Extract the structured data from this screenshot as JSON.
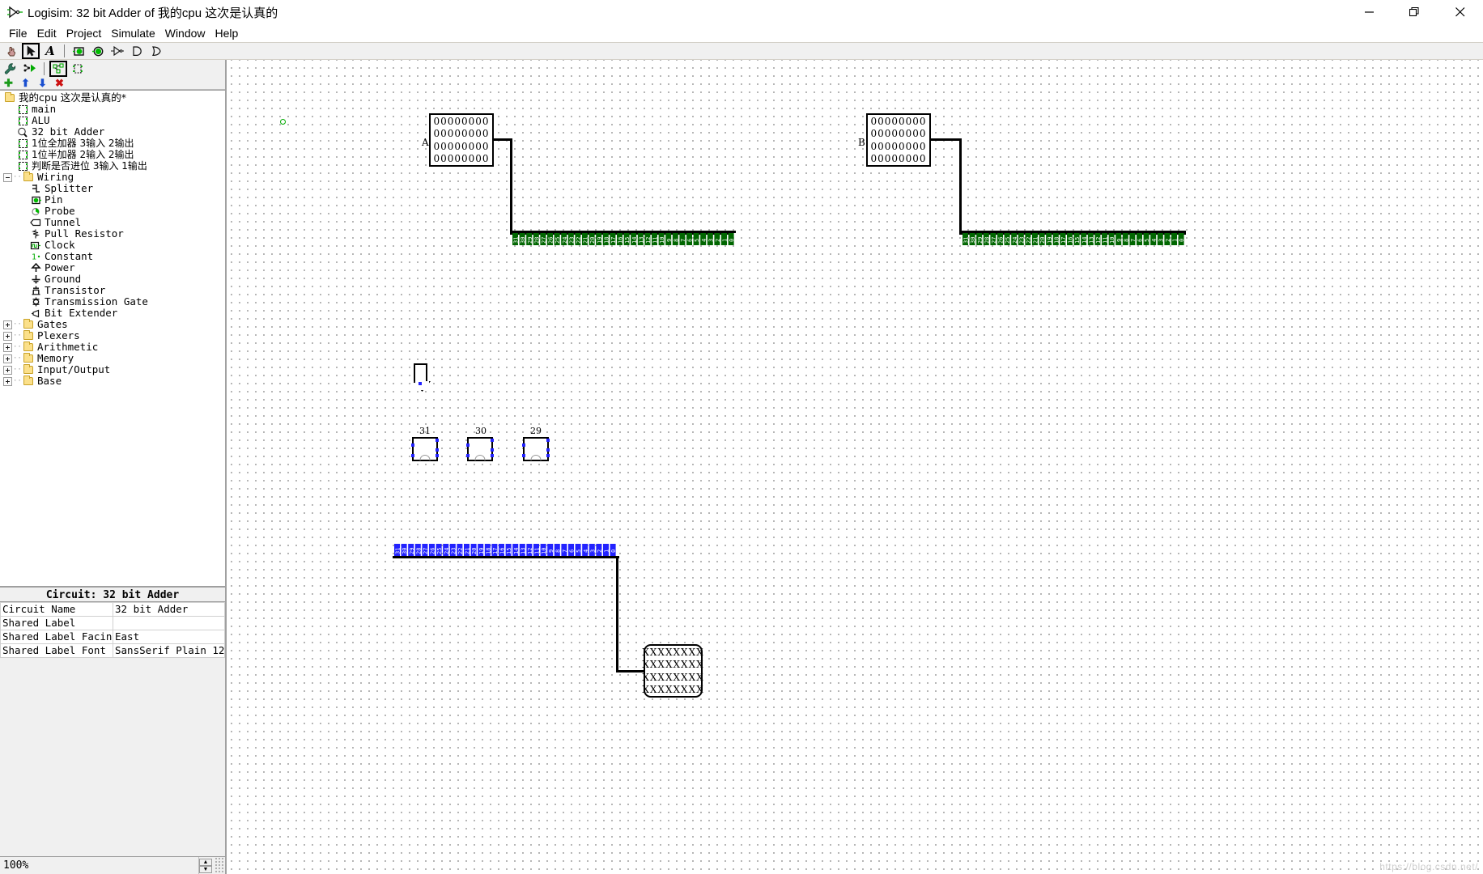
{
  "window": {
    "title": "Logisim: 32 bit Adder of 我的cpu 这次是认真的",
    "app_icon": "logisim-gate-icon",
    "minimize_label": "–",
    "maximize_label": "❐",
    "close_label": "✕"
  },
  "menubar": {
    "items": [
      {
        "label": "File",
        "name": "menu-file"
      },
      {
        "label": "Edit",
        "name": "menu-edit"
      },
      {
        "label": "Project",
        "name": "menu-project"
      },
      {
        "label": "Simulate",
        "name": "menu-simulate"
      },
      {
        "label": "Window",
        "name": "menu-window"
      },
      {
        "label": "Help",
        "name": "menu-help"
      }
    ]
  },
  "toolbar": {
    "tools": [
      {
        "name": "poke-tool",
        "icon": "hand-icon",
        "selected": false
      },
      {
        "name": "select-tool",
        "icon": "arrow-cursor-icon",
        "selected": true
      },
      {
        "name": "text-tool",
        "icon": "text-A-icon",
        "selected": false
      },
      {
        "name": "input-pin-tool",
        "icon": "input-pin-icon",
        "selected": false
      },
      {
        "name": "output-pin-tool",
        "icon": "output-pin-icon",
        "selected": false
      },
      {
        "name": "not-gate-tool",
        "icon": "not-gate-icon",
        "selected": false
      },
      {
        "name": "and-gate-tool",
        "icon": "and-gate-icon",
        "selected": false
      },
      {
        "name": "or-gate-tool",
        "icon": "or-gate-icon",
        "selected": false
      }
    ],
    "tools_row2": [
      {
        "name": "wrench-tool",
        "icon": "wrench-icon",
        "selected": false
      },
      {
        "name": "simulation-tool",
        "icon": "run-simulation-icon",
        "selected": false
      },
      {
        "name": "edit-circuit-tool",
        "icon": "edit-circuit-icon",
        "selected": true
      },
      {
        "name": "add-circuit-tool",
        "icon": "add-circuit-icon",
        "selected": false
      }
    ],
    "tools_row3": [
      {
        "name": "add-button",
        "icon": "plus-icon",
        "glyph": "✚",
        "color": "#1a9a1a"
      },
      {
        "name": "move-up-button",
        "icon": "arrow-up-icon",
        "glyph": "⬆",
        "color": "#1a4fd0"
      },
      {
        "name": "move-down-button",
        "icon": "arrow-down-icon",
        "glyph": "⬇",
        "color": "#1a4fd0"
      },
      {
        "name": "delete-button",
        "icon": "x-mark-icon",
        "glyph": "✖",
        "color": "#cc1111"
      }
    ]
  },
  "explorer": {
    "project_label": "我的cpu  这次是认真的*",
    "circuits": [
      {
        "label": "main",
        "name": "tree-item-main",
        "selected": false
      },
      {
        "label": "ALU",
        "name": "tree-item-alu",
        "selected": false
      },
      {
        "label": "32 bit Adder",
        "name": "tree-item-32-bit-adder",
        "selected": true
      },
      {
        "label": "1位全加器  3输入  2输出",
        "name": "tree-item-full-adder",
        "selected": false
      },
      {
        "label": "1位半加器  2输入  2输出",
        "name": "tree-item-half-adder",
        "selected": false
      },
      {
        "label": "判断是否进位  3输入  1输出",
        "name": "tree-item-carry-detect",
        "selected": false
      }
    ],
    "library_wiring": {
      "label": "Wiring",
      "expanded": true,
      "items": [
        {
          "label": "Splitter",
          "icon": "splitter-icon"
        },
        {
          "label": "Pin",
          "icon": "pin-icon"
        },
        {
          "label": "Probe",
          "icon": "probe-icon"
        },
        {
          "label": "Tunnel",
          "icon": "tunnel-icon"
        },
        {
          "label": "Pull Resistor",
          "icon": "pull-resistor-icon"
        },
        {
          "label": "Clock",
          "icon": "clock-icon"
        },
        {
          "label": "Constant",
          "icon": "constant-icon"
        },
        {
          "label": "Power",
          "icon": "power-icon"
        },
        {
          "label": "Ground",
          "icon": "ground-icon"
        },
        {
          "label": "Transistor",
          "icon": "transistor-icon"
        },
        {
          "label": "Transmission Gate",
          "icon": "transmission-gate-icon"
        },
        {
          "label": "Bit Extender",
          "icon": "bit-extender-icon"
        }
      ]
    },
    "libraries": [
      {
        "label": "Gates",
        "name": "tree-lib-gates"
      },
      {
        "label": "Plexers",
        "name": "tree-lib-plexers"
      },
      {
        "label": "Arithmetic",
        "name": "tree-lib-arithmetic"
      },
      {
        "label": "Memory",
        "name": "tree-lib-memory"
      },
      {
        "label": "Input/Output",
        "name": "tree-lib-input-output"
      },
      {
        "label": "Base",
        "name": "tree-lib-base"
      }
    ]
  },
  "attributes": {
    "title": "Circuit: 32 bit Adder",
    "rows": [
      {
        "key": "Circuit Name",
        "value": "32 bit Adder"
      },
      {
        "key": "Shared Label",
        "value": ""
      },
      {
        "key": "Shared Label Facing",
        "value": "East"
      },
      {
        "key": "Shared Label Font",
        "value": "SansSerif Plain 12"
      }
    ]
  },
  "statusbar": {
    "zoom": "100%",
    "spin_up": "▲",
    "spin_down": "▼"
  },
  "canvas": {
    "pin_a": {
      "label": "A",
      "value_rows": [
        "00000000",
        "00000000",
        "00000000",
        "00000000"
      ]
    },
    "pin_b": {
      "label": "B",
      "value_rows": [
        "00000000",
        "00000000",
        "00000000",
        "00000000"
      ]
    },
    "pin_out": {
      "label": "",
      "value_rows": [
        "XXXXXXXX",
        "XXXXXXXX",
        "XXXXXXXX",
        "XXXXXXXX"
      ]
    },
    "splitter_a_labels": [
      "31",
      "30",
      "29",
      "28",
      "27",
      "26",
      "25",
      "24",
      "23",
      "22",
      "21",
      "20",
      "19",
      "18",
      "17",
      "16",
      "15",
      "14",
      "13",
      "12",
      "11",
      "10",
      "9",
      "8",
      "7",
      "6",
      "5",
      "4",
      "3",
      "2",
      "1",
      "0"
    ],
    "splitter_b_labels": [
      "31",
      "30",
      "29",
      "28",
      "27",
      "26",
      "25",
      "24",
      "23",
      "22",
      "21",
      "20",
      "19",
      "18",
      "17",
      "16",
      "15",
      "14",
      "13",
      "12",
      "11",
      "10",
      "9",
      "8",
      "7",
      "6",
      "5",
      "4",
      "3",
      "2",
      "1",
      "0"
    ],
    "splitter_out_labels": [
      "31",
      "30",
      "29",
      "28",
      "27",
      "26",
      "25",
      "24",
      "23",
      "22",
      "21",
      "20",
      "19",
      "18",
      "17",
      "16",
      "15",
      "14",
      "13",
      "12",
      "11",
      "10",
      "9",
      "8",
      "7",
      "6",
      "5",
      "4",
      "3",
      "2",
      "1",
      "0"
    ],
    "subcircuits": [
      {
        "label": "31",
        "name": "subcircuit-bit-31"
      },
      {
        "label": "30",
        "name": "subcircuit-bit-30"
      },
      {
        "label": "29",
        "name": "subcircuit-bit-29"
      }
    ],
    "tunnel": {
      "label": "",
      "name": "canvas-tunnel"
    },
    "origin_node": {
      "name": "circuit-origin-node"
    },
    "watermark": "https://blog.csdn.net/"
  },
  "colors": {
    "wire_black": "#000000",
    "splitter_green": "#006600",
    "splitter_blue": "#2222ff",
    "pin_green": "#00b000",
    "accent_selection": "#cde8ff"
  }
}
